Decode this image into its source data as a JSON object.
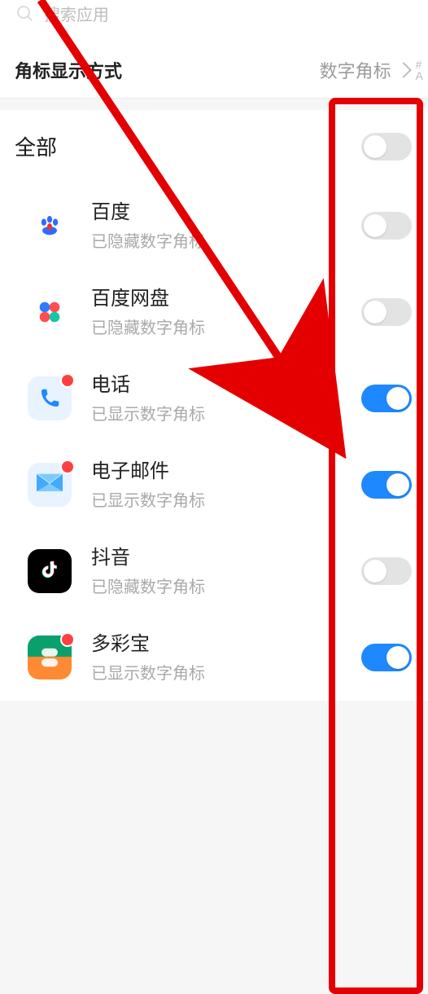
{
  "search": {
    "placeholder": "搜索应用"
  },
  "header": {
    "title": "角标显示方式",
    "value": "数字角标",
    "sidebar": [
      "#",
      "A"
    ]
  },
  "master": {
    "label": "全部",
    "on": false
  },
  "status_text": {
    "hidden": "已隐藏数字角标",
    "shown": "已显示数字角标"
  },
  "apps": [
    {
      "id": "baidu",
      "name": "百度",
      "status": "hidden",
      "on": false,
      "badge": false
    },
    {
      "id": "bdpan",
      "name": "百度网盘",
      "status": "hidden",
      "on": false,
      "badge": false
    },
    {
      "id": "phone",
      "name": "电话",
      "status": "shown",
      "on": true,
      "badge": true
    },
    {
      "id": "mail",
      "name": "电子邮件",
      "status": "shown",
      "on": true,
      "badge": true
    },
    {
      "id": "douyin",
      "name": "抖音",
      "status": "hidden",
      "on": false,
      "badge": false
    },
    {
      "id": "dcb",
      "name": "多彩宝",
      "status": "shown",
      "on": true,
      "badge": true
    }
  ],
  "annotation": {
    "color": "#e40000"
  }
}
